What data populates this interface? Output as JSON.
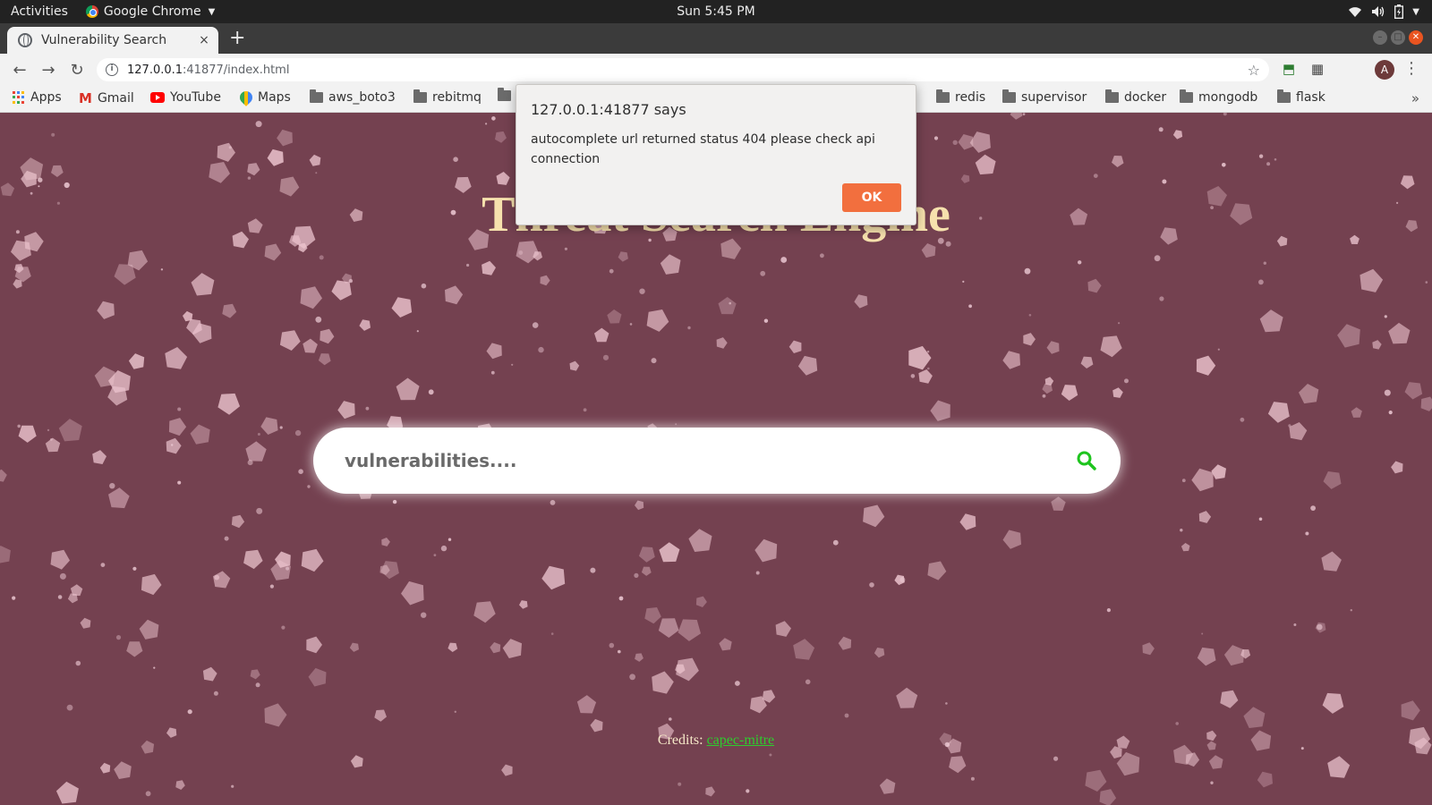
{
  "system_bar": {
    "activities": "Activities",
    "app_name": "Google Chrome",
    "clock": "Sun  5:45 PM",
    "icons": [
      "wifi-icon",
      "volume-icon",
      "battery-icon",
      "chevron-down-icon"
    ]
  },
  "browser": {
    "tab_title": "Vulnerability Search",
    "tab_close": "×",
    "new_tab": "+",
    "url_host": "127.0.0.1",
    "url_rest": ":41877/index.html",
    "bookmarks": [
      {
        "label": "Apps",
        "icon": "apps-grid-icon"
      },
      {
        "label": "Gmail",
        "icon": "gmail-icon"
      },
      {
        "label": "YouTube",
        "icon": "youtube-icon"
      },
      {
        "label": "Maps",
        "icon": "maps-icon"
      },
      {
        "label": "aws_boto3",
        "icon": "folder-icon"
      },
      {
        "label": "rebitmq",
        "icon": "folder-icon"
      },
      {
        "label": "",
        "icon": "folder-icon"
      },
      {
        "label": "redis",
        "icon": "folder-icon"
      },
      {
        "label": "supervisor",
        "icon": "folder-icon"
      },
      {
        "label": "docker",
        "icon": "folder-icon"
      },
      {
        "label": "mongodb",
        "icon": "folder-icon"
      },
      {
        "label": "flask",
        "icon": "folder-icon"
      }
    ],
    "profile_initial": "A",
    "more_bookmarks": "»"
  },
  "page": {
    "heading": "Threat Search Engine",
    "search_placeholder": "vulnerabilities....",
    "credits_label": "Credits: ",
    "credits_link": "capec-mitre"
  },
  "dialog": {
    "origin": "127.0.0.1:41877 says",
    "message": "autocomplete url returned status 404 please check api connection",
    "ok_label": "OK"
  },
  "colors": {
    "page_background": "#744150",
    "heading": "#f6e1ad",
    "search_icon": "#1ec41e",
    "ok_button": "#f26f3e",
    "credits_link": "#2ecc2e"
  }
}
